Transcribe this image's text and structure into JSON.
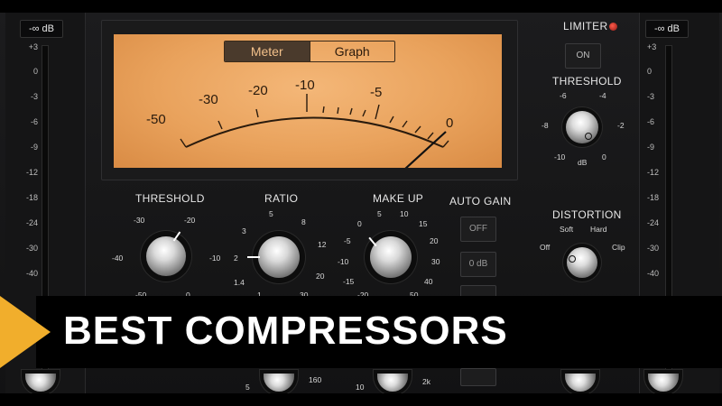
{
  "banner": {
    "text": "BEST COMPRESSORS"
  },
  "left_meter": {
    "readout": "-∞ dB",
    "scale": [
      "+3",
      "0",
      "-3",
      "-6",
      "-9",
      "-12",
      "-18",
      "-24",
      "-30",
      "-40"
    ]
  },
  "right_meter": {
    "readout": "-∞ dB",
    "scale": [
      "+3",
      "0",
      "-3",
      "-6",
      "-9",
      "-12",
      "-18",
      "-24",
      "-30",
      "-40"
    ]
  },
  "vu": {
    "tabs": [
      "Meter",
      "Graph"
    ],
    "active_tab": "Meter",
    "scale": [
      "-50",
      "-30",
      "-20",
      "-10",
      "-5",
      "0"
    ]
  },
  "threshold": {
    "label": "THRESHOLD",
    "marks": [
      "-30",
      "-20",
      "-40",
      "-10",
      "-50",
      "0"
    ]
  },
  "ratio": {
    "label": "RATIO",
    "marks": [
      "5",
      "8",
      "3",
      "12",
      "2",
      "20",
      "1.4",
      "1",
      "30"
    ]
  },
  "makeup": {
    "label": "MAKE UP",
    "marks": [
      "5",
      "10",
      "0",
      "15",
      "-5",
      "20",
      "-10",
      "30",
      "-15",
      "40",
      "-20",
      "50"
    ]
  },
  "auto_gain": {
    "label": "AUTO GAIN",
    "buttons": [
      "OFF",
      "0 dB"
    ]
  },
  "limiter": {
    "label": "LIMITER",
    "button": "ON",
    "threshold_label": "THRESHOLD",
    "marks": [
      "-6",
      "-4",
      "-8",
      "-2",
      "-10",
      "dB",
      "0"
    ]
  },
  "distortion": {
    "label": "DISTORTION",
    "marks": [
      "Soft",
      "Hard",
      "Off",
      "Clip"
    ]
  },
  "below_banner": {
    "ratio_marks": [
      "5",
      "160"
    ],
    "makeup_marks": [
      "10",
      "2k"
    ]
  },
  "colors": {
    "accent": "#f1ae2c",
    "vu_face": "#e9a25c",
    "led": "#ff3b2f"
  }
}
